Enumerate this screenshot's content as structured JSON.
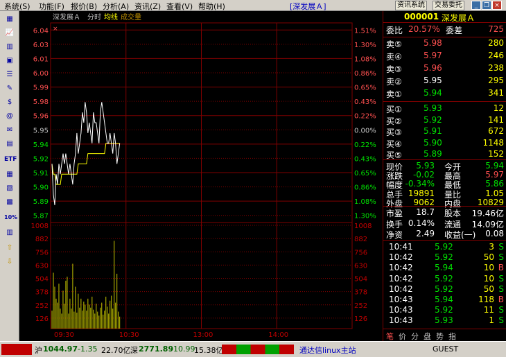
{
  "menu": {
    "items": [
      "系统(S)",
      "功能(F)",
      "报价(B)",
      "分析(A)",
      "资讯(Z)",
      "查看(V)",
      "帮助(H)"
    ],
    "title": "[深发展Ａ]",
    "info_btn": "资讯系统",
    "trade_btn": "交易委托"
  },
  "toolbar": {
    "etf": "ETF",
    "pct": "10%"
  },
  "chart": {
    "header": {
      "name": "深发展Ａ",
      "mode": "分时",
      "avg": "均线",
      "vol": "成交量"
    },
    "cross_mark": "×",
    "price_labels": [
      "6.04",
      "6.03",
      "6.01",
      "6.00",
      "5.99",
      "5.98",
      "5.96",
      "5.95",
      "5.94",
      "5.92",
      "5.91",
      "5.90",
      "5.89",
      "5.87"
    ],
    "pct_left_labels": [
      "1.51%",
      "1.30%",
      "1.08%",
      "0.86%",
      "0.65%",
      "0.43%",
      "0.22%",
      "0.00%",
      "0.22%",
      "0.43%",
      "0.65%",
      "0.86%",
      "1.08%",
      "1.30%"
    ],
    "vol_labels": [
      "1008",
      "882",
      "756",
      "630",
      "504",
      "378",
      "252",
      "126"
    ],
    "time_labels": [
      "09:30",
      "10:30",
      "13:00",
      "14:00"
    ]
  },
  "chart_data": {
    "type": "line",
    "prev_close": 5.95,
    "ylim": [
      5.86,
      6.04
    ],
    "price": [
      5.91,
      5.88,
      5.87,
      5.9,
      5.89,
      5.91,
      5.9,
      5.91,
      5.92,
      5.91,
      5.92,
      5.91,
      5.9,
      5.91,
      5.9,
      5.89,
      5.91,
      5.92,
      5.94,
      5.92,
      5.93,
      5.94,
      5.96,
      5.95,
      5.97,
      5.96,
      5.94,
      5.95,
      5.94,
      5.93,
      5.96,
      5.95,
      5.95,
      5.94,
      5.93,
      5.96,
      5.97,
      5.96,
      5.95,
      5.94,
      5.93,
      5.93,
      5.94,
      5.93,
      5.92,
      5.94,
      5.93,
      5.91,
      5.92,
      5.93
    ],
    "avg": [
      5.91,
      5.9,
      5.9,
      5.89,
      5.89,
      5.89,
      5.89,
      5.9,
      5.9,
      5.9,
      5.9,
      5.9,
      5.9,
      5.9,
      5.9,
      5.9,
      5.9,
      5.9,
      5.9,
      5.91,
      5.91,
      5.91,
      5.91,
      5.91,
      5.91,
      5.91,
      5.92,
      5.92,
      5.92,
      5.92,
      5.92,
      5.92,
      5.92,
      5.92,
      5.92,
      5.92,
      5.92,
      5.92,
      5.92,
      5.93,
      5.93,
      5.93,
      5.93,
      5.93,
      5.93,
      5.93,
      5.93,
      5.93,
      5.93,
      5.93
    ],
    "volume": [
      180,
      560,
      420,
      300,
      260,
      450,
      200,
      150,
      380,
      250,
      480,
      520,
      150,
      300,
      200,
      650,
      170,
      420,
      160,
      350,
      210,
      300,
      180,
      270,
      240,
      180,
      300,
      240,
      210,
      320,
      190,
      150,
      250,
      170,
      130,
      210,
      260,
      140,
      180,
      320,
      220,
      150,
      280,
      330,
      200,
      880,
      260,
      550,
      170,
      120
    ]
  },
  "quote": {
    "code": "000001",
    "name": "深发展Ａ",
    "wb": {
      "label": "委比",
      "value": "20.57%",
      "diff_label": "委差",
      "diff": "725"
    },
    "sells": [
      {
        "l": "卖⑤",
        "p": "5.98",
        "v": "280"
      },
      {
        "l": "卖④",
        "p": "5.97",
        "v": "246"
      },
      {
        "l": "卖③",
        "p": "5.96",
        "v": "238"
      },
      {
        "l": "卖②",
        "p": "5.95",
        "v": "295"
      },
      {
        "l": "卖①",
        "p": "5.94",
        "v": "341"
      }
    ],
    "buys": [
      {
        "l": "买①",
        "p": "5.93",
        "v": "12"
      },
      {
        "l": "买②",
        "p": "5.92",
        "v": "141"
      },
      {
        "l": "买③",
        "p": "5.91",
        "v": "672"
      },
      {
        "l": "买④",
        "p": "5.90",
        "v": "1148"
      },
      {
        "l": "买⑤",
        "p": "5.89",
        "v": "152"
      }
    ],
    "stats": [
      {
        "l1": "现价",
        "v1": "5.93",
        "l2": "今开",
        "v2": "5.94"
      },
      {
        "l1": "涨跌",
        "v1": "-0.02",
        "l2": "最高",
        "v2": "5.97"
      },
      {
        "l1": "幅度",
        "v1": "-0.34%",
        "l2": "最低",
        "v2": "5.86"
      },
      {
        "l1": "总手",
        "v1": "19891",
        "l2": "量比",
        "v2": "1.05"
      },
      {
        "l1": "外盘",
        "v1": "9062",
        "l2": "内盘",
        "v2": "10829"
      }
    ],
    "fin": [
      {
        "l1": "市盈",
        "v1": "18.7",
        "l2": "股本",
        "v2": "19.46亿"
      },
      {
        "l1": "换手",
        "v1": "0.14%",
        "l2": "流通",
        "v2": "14.09亿"
      },
      {
        "l1": "净资",
        "v1": "2.49",
        "l2": "收益(一)",
        "v2": "0.08"
      }
    ],
    "ticks": [
      {
        "t": "10:41",
        "p": "5.92",
        "v": "3",
        "s": "S"
      },
      {
        "t": "10:42",
        "p": "5.92",
        "v": "50",
        "s": "S"
      },
      {
        "t": "10:42",
        "p": "5.94",
        "v": "10",
        "s": "B"
      },
      {
        "t": "10:42",
        "p": "5.92",
        "v": "10",
        "s": "S"
      },
      {
        "t": "10:42",
        "p": "5.92",
        "v": "50",
        "s": "S"
      },
      {
        "t": "10:43",
        "p": "5.94",
        "v": "118",
        "s": "B"
      },
      {
        "t": "10:43",
        "p": "5.92",
        "v": "11",
        "s": "S"
      },
      {
        "t": "10:43",
        "p": "5.93",
        "v": "1",
        "s": "S"
      }
    ],
    "bottom_tabs": [
      "笔",
      "价",
      "分",
      "盘",
      "势",
      "指"
    ]
  },
  "status": {
    "sh_label": "沪",
    "sh_val": "1044.97",
    "sh_chg": "-1.35",
    "sh_amt": "22.70亿",
    "sz_label": "深",
    "sz_val": "2771.89",
    "sz_chg": "-10.99",
    "sz_amt": "15.38亿",
    "server": "通达信linux主站",
    "user": "GUEST"
  },
  "colors": {
    "up": "#ff5050",
    "down": "#00e000",
    "grid": "#800000",
    "price_line": "#ffffff",
    "avg_line": "#ffff00",
    "volume": "#c8c800"
  }
}
